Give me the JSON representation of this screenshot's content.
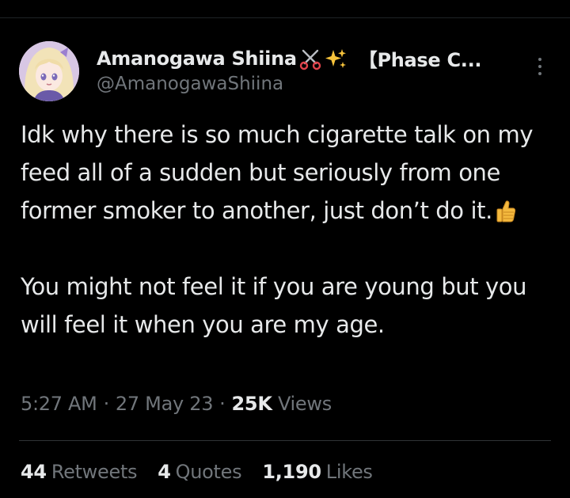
{
  "author": {
    "display_name": "Amanogawa Shiina",
    "name_emoji": [
      "scissors-icon",
      "sparkles-icon"
    ],
    "name_suffix": "【Phase C...",
    "handle": "@AmanogawaShiina"
  },
  "tweet": {
    "paragraph_1": "Idk why there is so much cigarette talk on my feed all of a sudden but seriously from one former smoker to another, just don’t do it.",
    "paragraph_1_emoji": "thumbs-up-icon",
    "paragraph_2": "You might not feel it if you are young but you will feel it when you are my age."
  },
  "meta": {
    "time": "5:27 AM",
    "separator": "·",
    "date": "27 May 23",
    "views_count": "25K",
    "views_label": "Views"
  },
  "stats": {
    "retweets_count": "44",
    "retweets_label": "Retweets",
    "quotes_count": "4",
    "quotes_label": "Quotes",
    "likes_count": "1,190",
    "likes_label": "Likes"
  },
  "colors": {
    "background": "#000000",
    "primary_text": "#e7e9ea",
    "secondary_text": "#71767b",
    "divider": "#2f3336"
  }
}
